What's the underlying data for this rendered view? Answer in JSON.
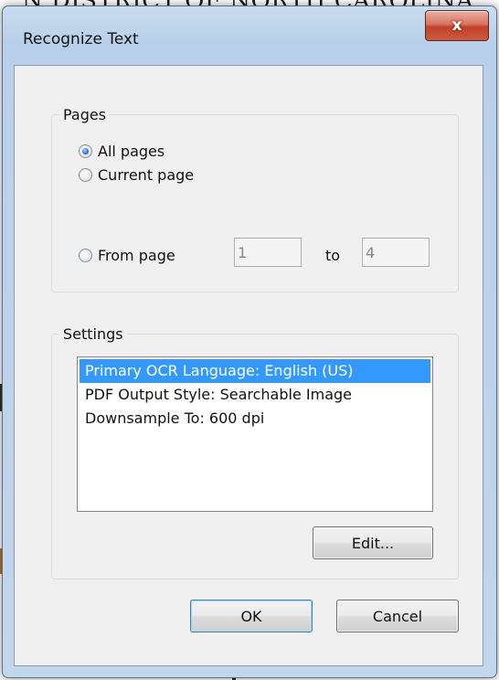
{
  "background_document": {
    "heading_fragment": "N DISTRICT OF NORTH CAROLINA"
  },
  "dialog": {
    "title": "Recognize Text",
    "close_glyph": "x",
    "pages": {
      "legend": "Pages",
      "options": [
        {
          "label": "All pages",
          "checked": true
        },
        {
          "label": "Current page",
          "checked": false
        },
        {
          "label": "From page",
          "checked": false
        }
      ],
      "from_value": "1",
      "to_label": "to",
      "to_value": "4"
    },
    "settings": {
      "legend": "Settings",
      "items": [
        {
          "label": "Primary OCR Language: English (US)",
          "selected": true
        },
        {
          "label": "PDF Output Style: Searchable Image",
          "selected": false
        },
        {
          "label": "Downsample To: 600 dpi",
          "selected": false
        }
      ],
      "edit_label": "Edit..."
    },
    "ok_label": "OK",
    "cancel_label": "Cancel"
  },
  "colors": {
    "selection": "#3399ff",
    "close_button": "#c0412a",
    "frame": "#b9d0ea"
  },
  "icons": {
    "close": "close-icon",
    "radio": "radio-button-icon"
  }
}
